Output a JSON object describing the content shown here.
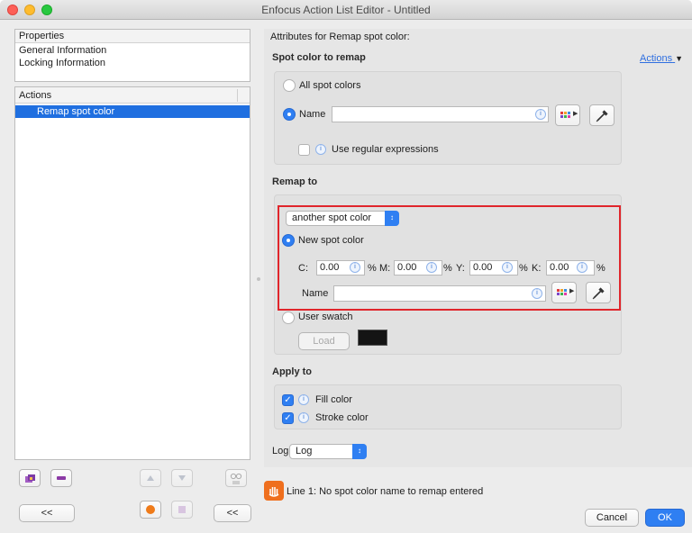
{
  "window": {
    "title": "Enfocus Action List Editor - Untitled"
  },
  "colors": {
    "accent": "#2f7ff2",
    "highlight_red": "#e0252b",
    "selection": "#1f6fe0"
  },
  "left": {
    "properties_header": "Properties",
    "properties_items": [
      "General Information",
      "Locking Information"
    ],
    "actions_header": "Actions",
    "actions_items": [
      "Remap spot color"
    ],
    "collapse_left_label": "<<",
    "collapse_right_label": "<<"
  },
  "right": {
    "attributes_title": "Attributes for Remap spot color:",
    "spot_section": {
      "label": "Spot color to remap",
      "actions_link": "Actions",
      "all_label": "All spot colors",
      "name_label": "Name",
      "name_value": "",
      "regex_label": "Use regular expressions"
    },
    "remap_section": {
      "label": "Remap to",
      "mode_value": "another spot color",
      "new_spot_label": "New spot color",
      "cmyk": [
        {
          "label": "C:",
          "value": "0.00",
          "unit": "%"
        },
        {
          "label": "M:",
          "value": "0.00",
          "unit": "%"
        },
        {
          "label": "Y:",
          "value": "0.00",
          "unit": "%"
        },
        {
          "label": "K:",
          "value": "0.00",
          "unit": "%"
        }
      ],
      "name_label": "Name",
      "name_value": "",
      "user_swatch_label": "User swatch",
      "load_label": "Load",
      "swatch_color": "#141414"
    },
    "apply_section": {
      "label": "Apply to",
      "fill_label": "Fill color",
      "stroke_label": "Stroke color"
    },
    "log": {
      "label": "Log",
      "value": "Log"
    }
  },
  "footer": {
    "message": "Line 1: No spot color name to remap entered",
    "cancel_label": "Cancel",
    "ok_label": "OK"
  },
  "icons": [
    "info-icon",
    "swatch-picker-icon",
    "eyedropper-icon",
    "warning-hand-icon",
    "preview-glasses-icon"
  ]
}
